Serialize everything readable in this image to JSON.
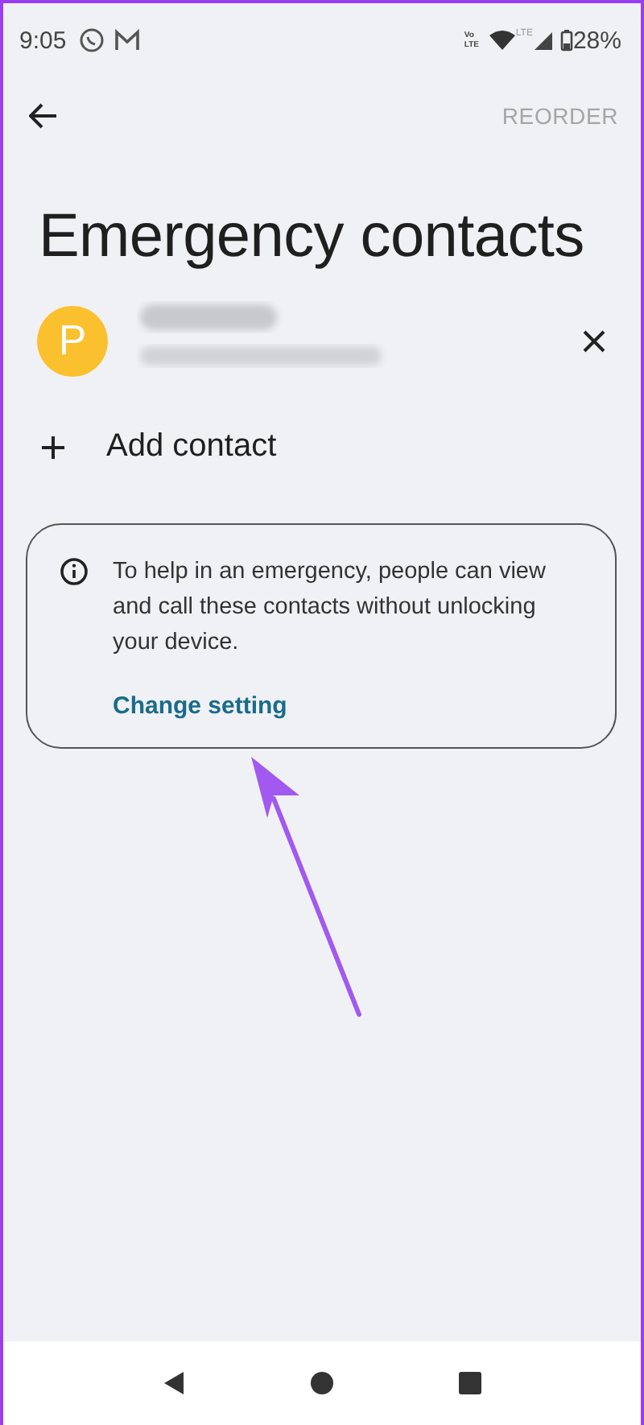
{
  "status_bar": {
    "time": "9:05",
    "volte": "Vo LTE",
    "network": "LTE",
    "battery": "28%"
  },
  "toolbar": {
    "action": "REORDER",
    "action_disabled": true
  },
  "title": "Emergency contacts",
  "contacts": [
    {
      "initial": "P",
      "color": "#fbc02d",
      "redacted": true
    }
  ],
  "add_contact": "Add contact",
  "info_card": {
    "text": "To help in an emergency, people can view and call these contacts without unlocking your device.",
    "link": "Change setting"
  },
  "annotation": {
    "kind": "arrow",
    "color": "#a259f0"
  }
}
